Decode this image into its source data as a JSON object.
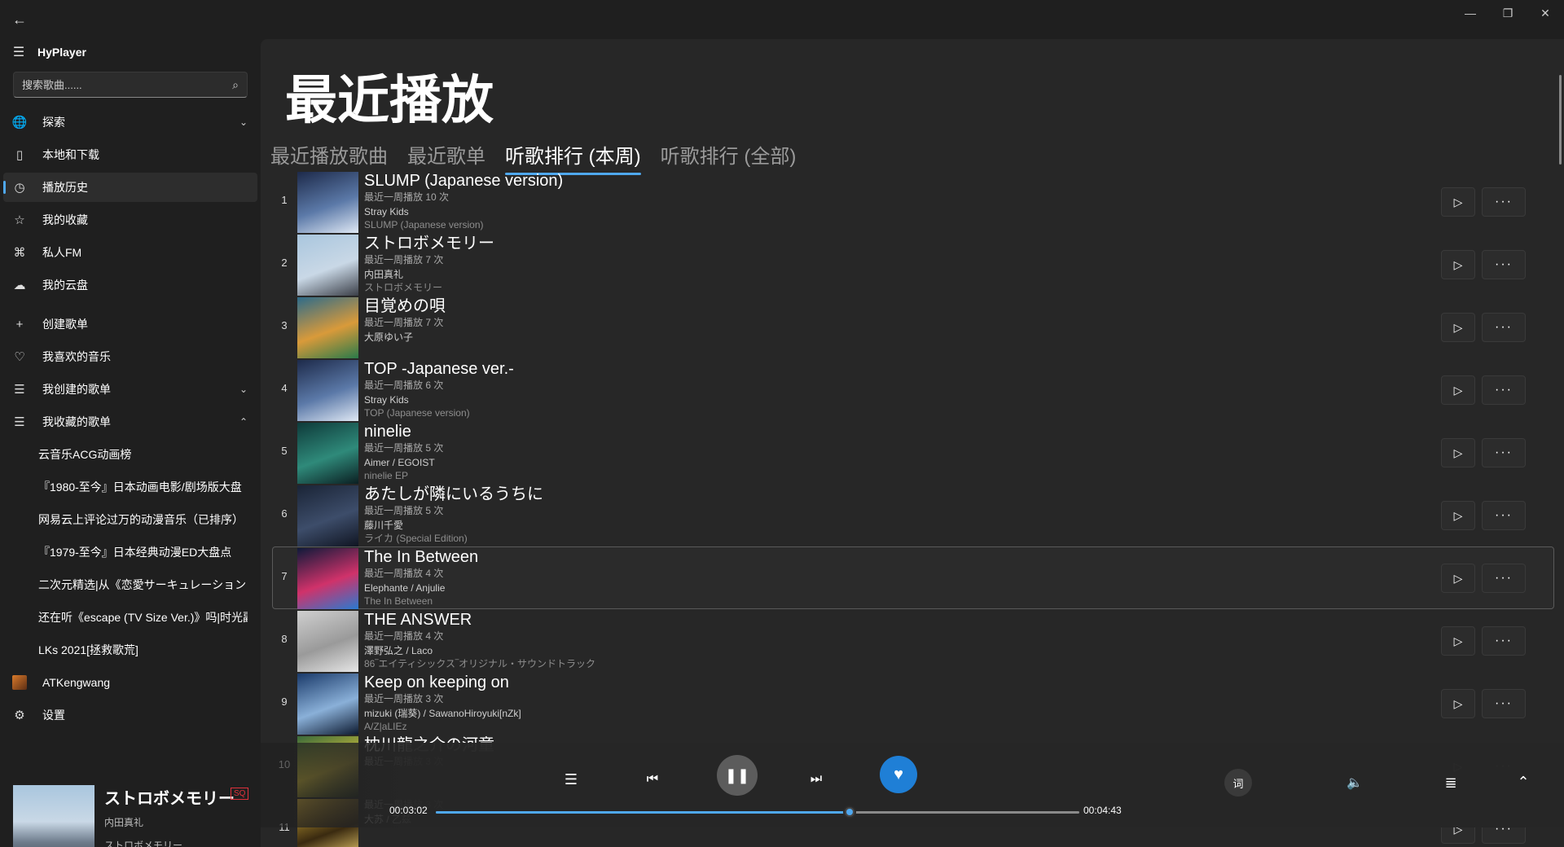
{
  "window": {
    "back": "←",
    "minimize": "—",
    "maximize": "❐",
    "close": "✕"
  },
  "app": {
    "title": "HyPlayer"
  },
  "search": {
    "placeholder": "搜索歌曲......"
  },
  "sidebar": {
    "nav": [
      {
        "label": "探索",
        "icon": "globe-icon",
        "glyph": "🌐",
        "chevron": "⌄"
      },
      {
        "label": "本地和下载",
        "icon": "device-icon",
        "glyph": "▯"
      },
      {
        "label": "播放历史",
        "icon": "clock-icon",
        "glyph": "◷",
        "active": true
      },
      {
        "label": "我的收藏",
        "icon": "star-icon",
        "glyph": "☆"
      },
      {
        "label": "私人FM",
        "icon": "radio-icon",
        "glyph": "⌘"
      },
      {
        "label": "我的云盘",
        "icon": "cloud-icon",
        "glyph": "☁"
      }
    ],
    "nav2": [
      {
        "label": "创建歌单",
        "icon": "plus-icon",
        "glyph": "+"
      },
      {
        "label": "我喜欢的音乐",
        "icon": "heart-icon",
        "glyph": "♡"
      },
      {
        "label": "我创建的歌单",
        "icon": "list-icon",
        "glyph": "☰",
        "chevron": "⌄"
      },
      {
        "label": "我收藏的歌单",
        "icon": "list-icon",
        "glyph": "☰",
        "chevron": "⌃"
      }
    ],
    "collected": [
      "云音乐ACG动画榜",
      "『1980-至今』日本动画电影/剧场版大盘",
      "网易云上评论过万的动漫音乐（已排序）",
      "『1979-至今』日本经典动漫ED大盘点",
      "二次元精选|从《恋愛サーキュレーション",
      "还在听《escape (TV Size Ver.)》吗|时光副",
      "LKs 2021[拯救歌荒]"
    ],
    "user": {
      "label": "ATKengwang"
    },
    "settings": {
      "label": "设置",
      "glyph": "⚙"
    }
  },
  "now_playing": {
    "title": "ストロボメモリー",
    "badge": "SQ",
    "artist": "内田真礼",
    "album": "ストロボメモリー"
  },
  "page": {
    "title": "最近播放",
    "tabs": [
      "最近播放歌曲",
      "最近歌单",
      "听歌排行 (本周)",
      "听歌排行 (全部)"
    ],
    "selected_tab": 2
  },
  "songs": [
    {
      "rank": "1",
      "title": "SLUMP (Japanese version)",
      "count": "最近一周播放 10 次",
      "artist": "Stray Kids",
      "album": "SLUMP (Japanese version)",
      "cover": [
        "#1d2a4a",
        "#5b79a8",
        "#dfe8f4"
      ]
    },
    {
      "rank": "2",
      "title": "ストロボメモリー",
      "count": "最近一周播放 7 次",
      "artist": "内田真礼",
      "album": "ストロボメモリー",
      "cover": [
        "#a9c6de",
        "#c9d8e6",
        "#3b3f48"
      ]
    },
    {
      "rank": "3",
      "title": "目覚めの唄",
      "count": "最近一周播放 7 次",
      "artist": "大原ゆい子",
      "album": "",
      "cover": [
        "#2d6b8a",
        "#d99a3a",
        "#2a7a4a"
      ]
    },
    {
      "rank": "4",
      "title": "TOP -Japanese ver.-",
      "count": "最近一周播放 6 次",
      "artist": "Stray Kids",
      "album": "TOP (Japanese version)",
      "cover": [
        "#1d2a4a",
        "#5b79a8",
        "#dfe8f4"
      ]
    },
    {
      "rank": "5",
      "title": "ninelie",
      "count": "最近一周播放 5 次",
      "artist": "Aimer / EGOIST",
      "album": "ninelie EP",
      "cover": [
        "#0e3a3a",
        "#2f8a7a",
        "#0b1f22"
      ]
    },
    {
      "rank": "6",
      "title": "あたしが隣にいるうちに",
      "count": "最近一周播放 5 次",
      "artist": "藤川千愛",
      "album": "ライカ (Special Edition)",
      "cover": [
        "#1a2436",
        "#3d4d6a",
        "#101522"
      ]
    },
    {
      "rank": "7",
      "title": "The In Between",
      "count": "最近一周播放 4 次",
      "artist": "Elephante / Anjulie",
      "album": "The In Between",
      "cover": [
        "#0f1a3a",
        "#d0326a",
        "#2a7ad0"
      ]
    },
    {
      "rank": "8",
      "title": "THE ANSWER",
      "count": "最近一周播放 4 次",
      "artist": "澤野弘之 / Laco",
      "album": "86‾エイティシックス‾オリジナル・サウンドトラック",
      "cover": [
        "#cfcfcf",
        "#9a9a9a",
        "#e6e6e6"
      ]
    },
    {
      "rank": "9",
      "title": "Keep on keeping on",
      "count": "最近一周播放 3 次",
      "artist": "mizuki (瑞葵) / SawanoHiroyuki[nZk]",
      "album": "A/Z|aLIEz",
      "cover": [
        "#1a3a6a",
        "#8ab0d8",
        "#0d1a30"
      ]
    },
    {
      "rank": "10",
      "title": "枕川龍之介の河童",
      "count": "最近一周播放 3 次",
      "artist": "",
      "album": "",
      "cover": [
        "#3a6a3a",
        "#d8c23a",
        "#1a2a1a"
      ]
    },
    {
      "rank": "11",
      "title": "",
      "count": "最近一周播放 3 次",
      "artist": "大苏 / 乙兹",
      "album": "",
      "cover": [
        "#d8b23a",
        "#3a2a10",
        "#f0d070"
      ]
    }
  ],
  "player": {
    "current_time": "00:03:02",
    "total_time": "00:04:43",
    "progress": 0.643,
    "lyric_label": "词",
    "icons": {
      "list": "☰",
      "prev": "⏮",
      "pause": "❚❚",
      "next": "⏭",
      "like": "♥",
      "volume": "🔈",
      "queue": "≣",
      "expand": "⌃"
    }
  },
  "row_buttons": {
    "play": "▷",
    "more": "···"
  },
  "colors": {
    "accent": "#4fa8ef",
    "like": "#1f7fd6",
    "badge": "#e0323c"
  }
}
